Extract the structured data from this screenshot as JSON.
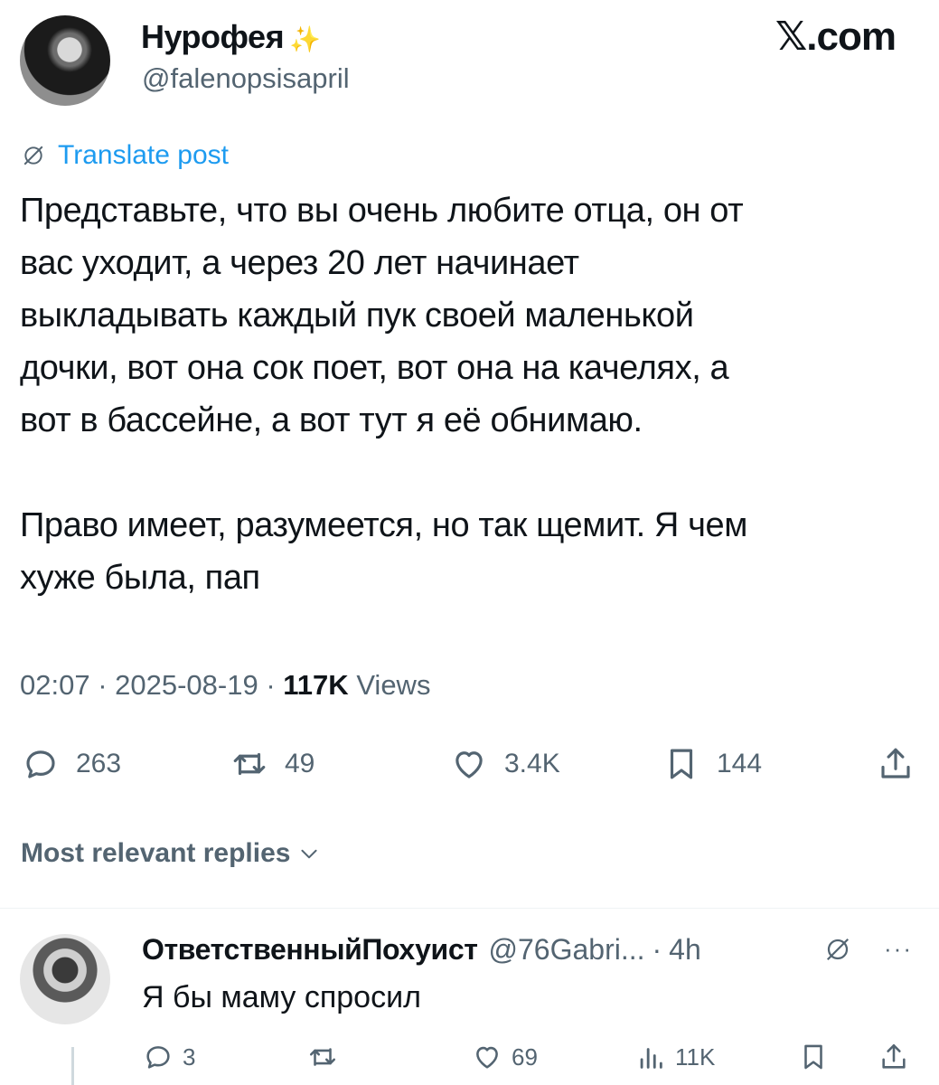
{
  "brand": "𝕏.com",
  "post": {
    "author_name": "Нурофея",
    "author_sparkle": "✨",
    "author_handle": "@falenopsisapril",
    "translate_label": "Translate post",
    "text": "Представьте, что вы очень любите отца, он от\nвас уходит, а через 20 лет начинает\nвыкладывать каждый пук своей маленькой\nдочки, вот она сок поет, вот она на качелях, а\nвот в бассейне, а вот тут я её обнимаю.\n\nПраво имеет, разумеется, но так щемит. Я чем\nхуже была, пап",
    "time": "02:07",
    "date": "2025-08-19",
    "views_count": "117K",
    "views_label": "Views",
    "replies": "263",
    "reposts": "49",
    "likes": "3.4K",
    "bookmarks": "144"
  },
  "replies_sort": {
    "label": "Most relevant replies"
  },
  "reply": {
    "author_name": "ОтветственныйПохуист",
    "author_handle": "@76Gabri...",
    "separator": "·",
    "age": "4h",
    "more": "···",
    "text": "Я бы маму спросил",
    "replies": "3",
    "reposts": "",
    "likes": "69",
    "views": "11K"
  },
  "colors": {
    "accent": "#1d9bf0",
    "text": "#0f1419",
    "muted": "#536471",
    "divider": "#eff3f4"
  },
  "icons": [
    "reply-icon",
    "repost-icon",
    "like-icon",
    "bookmark-icon",
    "share-icon",
    "globe-icon",
    "views-icon",
    "chevron-down-icon"
  ]
}
